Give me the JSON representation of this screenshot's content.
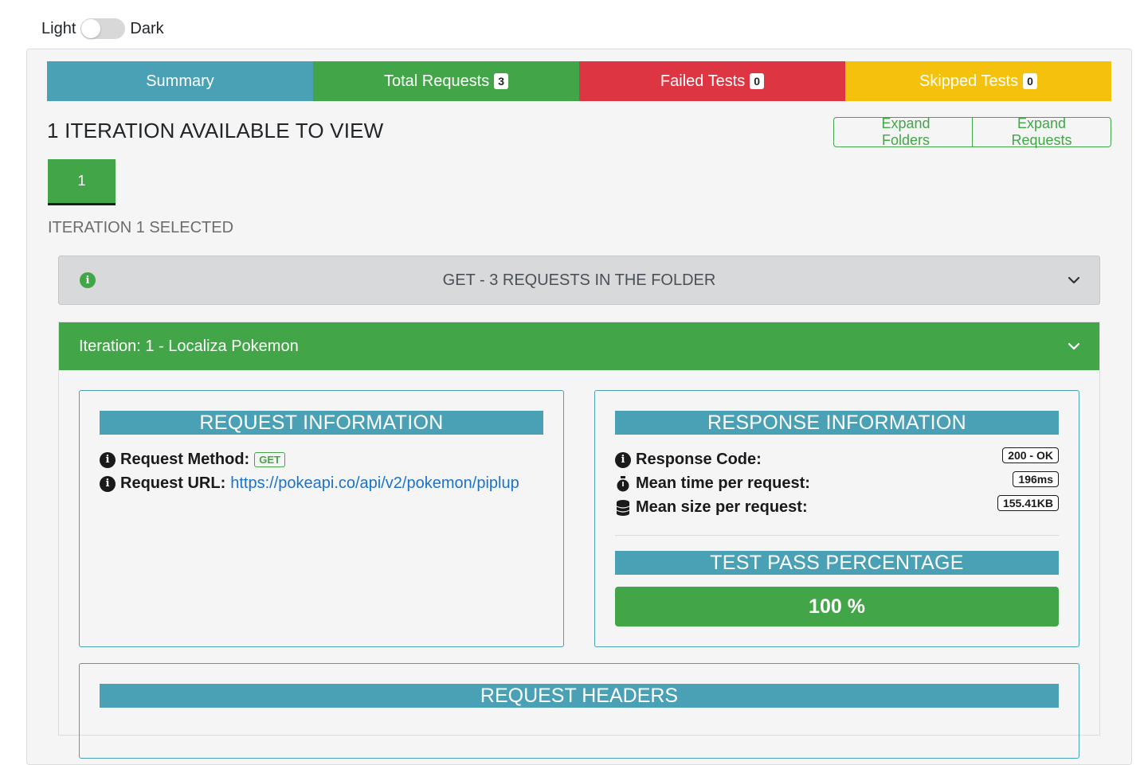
{
  "theme": {
    "light_label": "Light",
    "dark_label": "Dark"
  },
  "tabs": [
    {
      "label": "Summary"
    },
    {
      "label": "Total Requests",
      "count": "3"
    },
    {
      "label": "Failed Tests",
      "count": "0"
    },
    {
      "label": "Skipped Tests",
      "count": "0"
    }
  ],
  "iterations": {
    "title": "1 ITERATION AVAILABLE TO VIEW",
    "expand_folders": "Expand Folders",
    "expand_requests": "Expand Requests",
    "buttons": [
      "1"
    ],
    "selected_text": "ITERATION 1 SELECTED"
  },
  "folder": {
    "title": "GET - 3 REQUESTS IN THE FOLDER"
  },
  "request": {
    "header": "Iteration: 1 - Localiza Pokemon",
    "request_info": {
      "title": "REQUEST INFORMATION",
      "method_label": "Request Method:",
      "method_value": "GET",
      "url_label": "Request URL:",
      "url_value": "https://pokeapi.co/api/v2/pokemon/piplup"
    },
    "response_info": {
      "title": "RESPONSE INFORMATION",
      "code_label": "Response Code:",
      "code_value": "200 - OK",
      "time_label": "Mean time per request:",
      "time_value": "196ms",
      "size_label": "Mean size per request:",
      "size_value": "155.41KB",
      "pass_title": "TEST PASS PERCENTAGE",
      "pass_value": "100 %"
    },
    "headers_title": "REQUEST HEADERS"
  },
  "colors": {
    "info": "#4aa0b5",
    "success": "#42a648",
    "danger": "#dd3542",
    "warning": "#f4c20d"
  }
}
